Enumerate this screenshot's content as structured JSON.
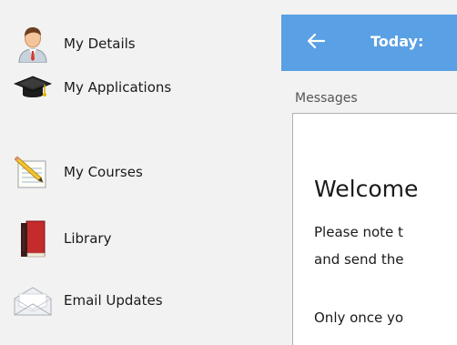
{
  "sidebar": {
    "items": [
      {
        "label": "My Details",
        "icon": "person-icon"
      },
      {
        "label": "My Applications",
        "icon": "graduation-cap-icon"
      },
      {
        "label": "My Courses",
        "icon": "notepad-pencil-icon"
      },
      {
        "label": "Library",
        "icon": "book-icon"
      },
      {
        "label": "Email Updates",
        "icon": "envelope-icon"
      }
    ]
  },
  "header": {
    "title": "Today: ",
    "back_icon": "arrow-left-icon",
    "color": "#5aa0e4"
  },
  "messages": {
    "section_label": "Messages",
    "heading": "Welcome",
    "lines": [
      "Please note t",
      "and send the",
      "Only once yo"
    ]
  }
}
